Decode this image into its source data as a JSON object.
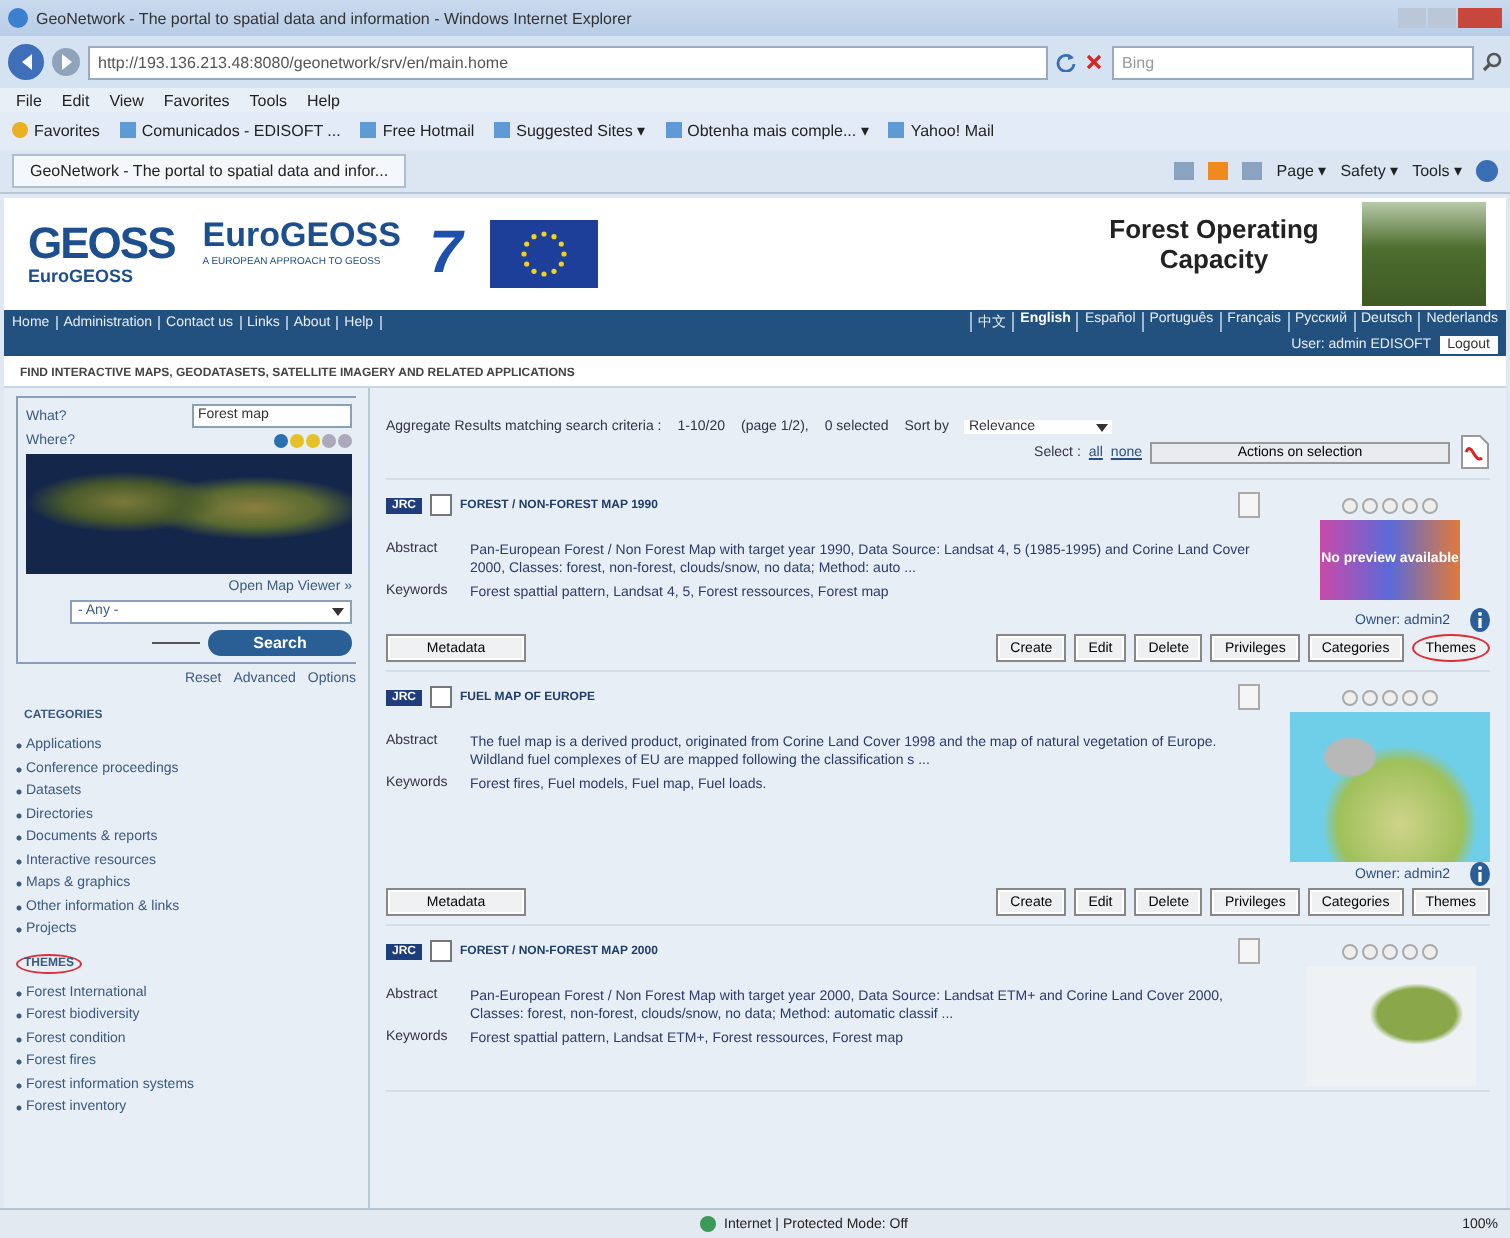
{
  "window": {
    "title": "GeoNetwork - The portal to spatial data and information - Windows Internet Explorer"
  },
  "address_bar": {
    "url": "http://193.136.213.48:8080/geonetwork/srv/en/main.home",
    "search_placeholder": "Bing"
  },
  "menu": [
    "File",
    "Edit",
    "View",
    "Favorites",
    "Tools",
    "Help"
  ],
  "favorites_bar": [
    {
      "label": "Favorites",
      "kind": "star"
    },
    {
      "label": "Comunicados - EDISOFT ...",
      "kind": "page"
    },
    {
      "label": "Free Hotmail",
      "kind": "page"
    },
    {
      "label": "Suggested Sites ▾",
      "kind": "page"
    },
    {
      "label": "Obtenha mais comple... ▾",
      "kind": "page"
    },
    {
      "label": "Yahoo! Mail",
      "kind": "page"
    }
  ],
  "tab": {
    "label": "GeoNetwork - The portal to spatial data and infor...",
    "selected": true
  },
  "command_bar": [
    "Page ▾",
    "Safety ▾",
    "Tools ▾"
  ],
  "header": {
    "logo": "GEOSS",
    "brand": "EuroGEOSS",
    "brand_small": "EuroGEOSS",
    "tagline": "A EUROPEAN APPROACH TO GEOSS",
    "fp7": "7",
    "title": "Forest Operating Capacity"
  },
  "nav": {
    "links": [
      "Home",
      "Administration",
      "Contact us",
      "Links",
      "About",
      "Help"
    ],
    "languages": [
      {
        "label": "中文",
        "selected": false
      },
      {
        "label": "English",
        "selected": true
      },
      {
        "label": "Español",
        "selected": false
      },
      {
        "label": "Português",
        "selected": false
      },
      {
        "label": "Français",
        "selected": false
      },
      {
        "label": "Русский",
        "selected": false
      },
      {
        "label": "Deutsch",
        "selected": false
      },
      {
        "label": "Nederlands",
        "selected": false
      }
    ],
    "user": "User: admin EDISOFT",
    "logout": "Logout"
  },
  "heading": "FIND INTERACTIVE MAPS, GEODATASETS, SATELLITE IMAGERY AND RELATED APPLICATIONS",
  "search": {
    "what_label": "What?",
    "what_value": "Forest map",
    "where_label": "Where?",
    "map_link": "Open Map Viewer »",
    "region": "- Any -",
    "button": "Search",
    "links": [
      "Reset",
      "Advanced",
      "Options"
    ]
  },
  "categories": {
    "title": "CATEGORIES",
    "circled": false,
    "items": [
      "Applications",
      "Conference proceedings",
      "Datasets",
      "Directories",
      "Documents & reports",
      "Interactive resources",
      "Maps & graphics",
      "Other information & links",
      "Projects"
    ]
  },
  "themes": {
    "title": "THEMES",
    "circled": true,
    "items": [
      "Forest International",
      "Forest biodiversity",
      "Forest condition",
      "Forest fires",
      "Forest information systems",
      "Forest inventory"
    ]
  },
  "results": {
    "summary": "Aggregate Results matching search criteria :",
    "range": "1-10/20",
    "page": "(page 1/2),",
    "selected_count": "0 selected",
    "sort_label": "Sort by",
    "sort_value": "Relevance",
    "select_label": "Select :",
    "select_all": "all",
    "select_none": "none",
    "actions": "Actions on selection"
  },
  "records": [
    {
      "agency": "JRC",
      "title": "FOREST / NON-FOREST MAP 1990",
      "checked": false,
      "stars": 0,
      "thumbnail": {
        "kind": "none",
        "text": "No preview available"
      },
      "abstract_label": "Abstract",
      "keywords_label": "Keywords",
      "abstract": "Pan-European Forest / Non Forest Map with target year 1990, Data Source: Landsat 4, 5 (1985-1995) and Corine Land Cover 2000, Classes: forest, non-forest, clouds/snow, no data; Method: auto ...",
      "keywords": "Forest spattial pattern, Landsat 4, 5, Forest ressources, Forest map",
      "owner": "Owner: admin2",
      "buttons": [
        {
          "label": "Metadata",
          "circled": false
        },
        {
          "label": "Create",
          "circled": false
        },
        {
          "label": "Edit",
          "circled": false
        },
        {
          "label": "Delete",
          "circled": false
        },
        {
          "label": "Privileges",
          "circled": false
        },
        {
          "label": "Categories",
          "circled": false
        },
        {
          "label": "Themes",
          "circled": true
        }
      ]
    },
    {
      "agency": "JRC",
      "title": "FUEL MAP OF EUROPE",
      "checked": false,
      "stars": 0,
      "thumbnail": {
        "kind": "europe"
      },
      "abstract_label": "Abstract",
      "keywords_label": "Keywords",
      "abstract": "The fuel map is a derived product, originated from Corine Land Cover 1998 and the map of natural vegetation of Europe. Wildland fuel complexes of EU are mapped following the classification s ...",
      "keywords": "Forest fires, Fuel models, Fuel map, Fuel loads.",
      "owner": "Owner: admin2",
      "buttons": [
        {
          "label": "Metadata",
          "circled": false
        },
        {
          "label": "Create",
          "circled": false
        },
        {
          "label": "Edit",
          "circled": false
        },
        {
          "label": "Delete",
          "circled": false
        },
        {
          "label": "Privileges",
          "circled": false
        },
        {
          "label": "Categories",
          "circled": false
        },
        {
          "label": "Themes",
          "circled": false
        }
      ]
    },
    {
      "agency": "JRC",
      "title": "FOREST / NON-FOREST MAP 2000",
      "checked": false,
      "stars": 0,
      "thumbnail": {
        "kind": "scandinavia"
      },
      "abstract_label": "Abstract",
      "keywords_label": "Keywords",
      "abstract": "Pan-European Forest / Non Forest Map with target year 2000, Data Source: Landsat ETM+ and Corine Land Cover 2000, Classes: forest, non-forest, clouds/snow, no data; Method: automatic classif ...",
      "keywords": "Forest spattial pattern, Landsat ETM+, Forest ressources, Forest map"
    }
  ],
  "status_bar": {
    "zone": "Internet | Protected Mode: Off",
    "zoom": "100%"
  }
}
